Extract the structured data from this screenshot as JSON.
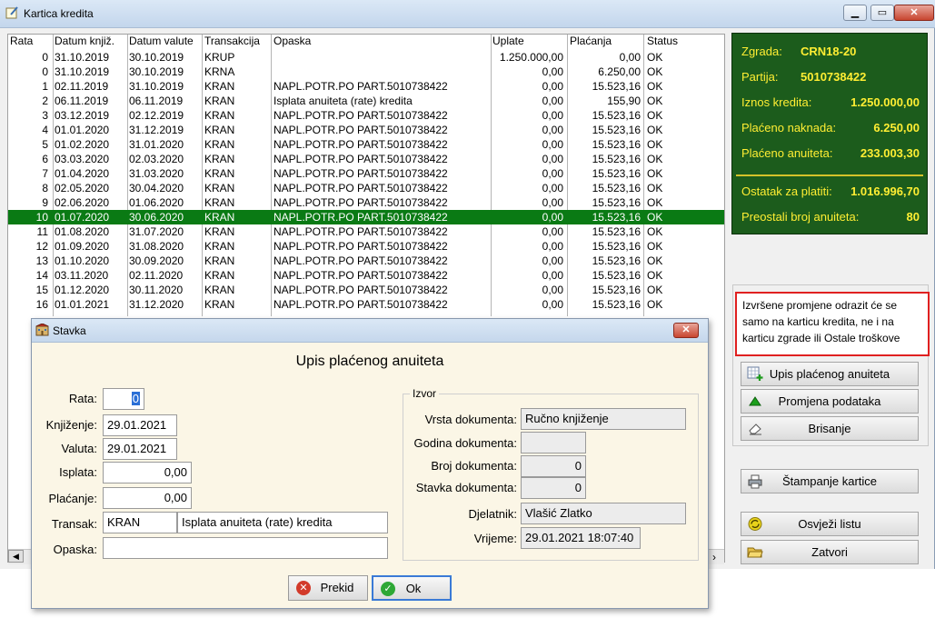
{
  "window": {
    "title": "Kartica kredita"
  },
  "table": {
    "headers": [
      "Rata",
      "Datum knjiž.",
      "Datum valute",
      "Transakcija",
      "Opaska",
      "Uplate",
      "Plaćanja",
      "Status"
    ],
    "selected_index": 11,
    "rows": [
      [
        "0",
        "31.10.2019",
        "30.10.2019",
        "KRUP",
        "",
        "1.250.000,00",
        "0,00",
        "OK"
      ],
      [
        "0",
        "31.10.2019",
        "30.10.2019",
        "KRNA",
        "",
        "0,00",
        "6.250,00",
        "OK"
      ],
      [
        "1",
        "02.11.2019",
        "31.10.2019",
        "KRAN",
        "NAPL.POTR.PO PART.5010738422",
        "0,00",
        "15.523,16",
        "OK"
      ],
      [
        "2",
        "06.11.2019",
        "06.11.2019",
        "KRAN",
        "Isplata anuiteta (rate) kredita",
        "0,00",
        "155,90",
        "OK"
      ],
      [
        "3",
        "03.12.2019",
        "02.12.2019",
        "KRAN",
        "NAPL.POTR.PO PART.5010738422",
        "0,00",
        "15.523,16",
        "OK"
      ],
      [
        "4",
        "01.01.2020",
        "31.12.2019",
        "KRAN",
        "NAPL.POTR.PO PART.5010738422",
        "0,00",
        "15.523,16",
        "OK"
      ],
      [
        "5",
        "01.02.2020",
        "31.01.2020",
        "KRAN",
        "NAPL.POTR.PO PART.5010738422",
        "0,00",
        "15.523,16",
        "OK"
      ],
      [
        "6",
        "03.03.2020",
        "02.03.2020",
        "KRAN",
        "NAPL.POTR.PO PART.5010738422",
        "0,00",
        "15.523,16",
        "OK"
      ],
      [
        "7",
        "01.04.2020",
        "31.03.2020",
        "KRAN",
        "NAPL.POTR.PO PART.5010738422",
        "0,00",
        "15.523,16",
        "OK"
      ],
      [
        "8",
        "02.05.2020",
        "30.04.2020",
        "KRAN",
        "NAPL.POTR.PO PART.5010738422",
        "0,00",
        "15.523,16",
        "OK"
      ],
      [
        "9",
        "02.06.2020",
        "01.06.2020",
        "KRAN",
        "NAPL.POTR.PO PART.5010738422",
        "0,00",
        "15.523,16",
        "OK"
      ],
      [
        "10",
        "01.07.2020",
        "30.06.2020",
        "KRAN",
        "NAPL.POTR.PO PART.5010738422",
        "0,00",
        "15.523,16",
        "OK"
      ],
      [
        "11",
        "01.08.2020",
        "31.07.2020",
        "KRAN",
        "NAPL.POTR.PO PART.5010738422",
        "0,00",
        "15.523,16",
        "OK"
      ],
      [
        "12",
        "01.09.2020",
        "31.08.2020",
        "KRAN",
        "NAPL.POTR.PO PART.5010738422",
        "0,00",
        "15.523,16",
        "OK"
      ],
      [
        "13",
        "01.10.2020",
        "30.09.2020",
        "KRAN",
        "NAPL.POTR.PO PART.5010738422",
        "0,00",
        "15.523,16",
        "OK"
      ],
      [
        "14",
        "03.11.2020",
        "02.11.2020",
        "KRAN",
        "NAPL.POTR.PO PART.5010738422",
        "0,00",
        "15.523,16",
        "OK"
      ],
      [
        "15",
        "01.12.2020",
        "30.11.2020",
        "KRAN",
        "NAPL.POTR.PO PART.5010738422",
        "0,00",
        "15.523,16",
        "OK"
      ],
      [
        "16",
        "01.01.2021",
        "31.12.2020",
        "KRAN",
        "NAPL.POTR.PO PART.5010738422",
        "0,00",
        "15.523,16",
        "OK"
      ]
    ]
  },
  "info": {
    "zgrada_label": "Zgrada:",
    "zgrada": "CRN18-20",
    "partija_label": "Partija:",
    "partija": "5010738422",
    "iznos_label": "Iznos kredita:",
    "iznos": "1.250.000,00",
    "naknada_label": "Plaćeno naknada:",
    "naknada": "6.250,00",
    "anuiteta_label": "Plaćeno anuiteta:",
    "anuiteta": "233.003,30",
    "ostatak_label": "Ostatak za platiti:",
    "ostatak": "1.016.996,70",
    "preostali_label": "Preostali broj anuiteta:",
    "preostali": "80"
  },
  "notice": {
    "text": "Izvršene promjene odrazit će se samo na karticu kredita, ne i na karticu zgrade ili Ostale troškove"
  },
  "buttons": {
    "upis": "Upis plaćenog anuiteta",
    "promjena": "Promjena podataka",
    "brisanje": "Brisanje",
    "stampanje": "Štampanje kartice",
    "osvjezi": "Osvježi listu",
    "zatvori": "Zatvori"
  },
  "dialog": {
    "title": "Stavka",
    "heading": "Upis plaćenog anuiteta",
    "labels": {
      "rata": "Rata:",
      "knjizenje": "Knjiženje:",
      "valuta": "Valuta:",
      "isplata": "Isplata:",
      "placanje": "Plaćanje:",
      "transak": "Transak:",
      "opaska": "Opaska:"
    },
    "values": {
      "rata": "0",
      "knjizenje": "29.01.2021",
      "valuta": "29.01.2021",
      "isplata": "0,00",
      "placanje": "0,00",
      "transak_code": "KRAN",
      "transak_desc": "Isplata anuiteta (rate) kredita",
      "opaska": ""
    },
    "izvor": {
      "legend": "Izvor",
      "vrsta_label": "Vrsta dokumenta:",
      "vrsta": "Ručno knjiženje",
      "godina_label": "Godina dokumenta:",
      "godina": "",
      "broj_label": "Broj dokumenta:",
      "broj": "0",
      "stavka_label": "Stavka dokumenta:",
      "stavka": "0",
      "djelatnik_label": "Djelatnik:",
      "djelatnik": "Vlašić Zlatko",
      "vrijeme_label": "Vrijeme:",
      "vrijeme": "29.01.2021 18:07:40"
    },
    "prekid": "Prekid",
    "ok": "Ok"
  },
  "colors": {
    "selected_row": "#0a7a14",
    "info_bg": "#1c5c1c",
    "info_text": "#ffee33",
    "notice_border": "#e02020"
  }
}
